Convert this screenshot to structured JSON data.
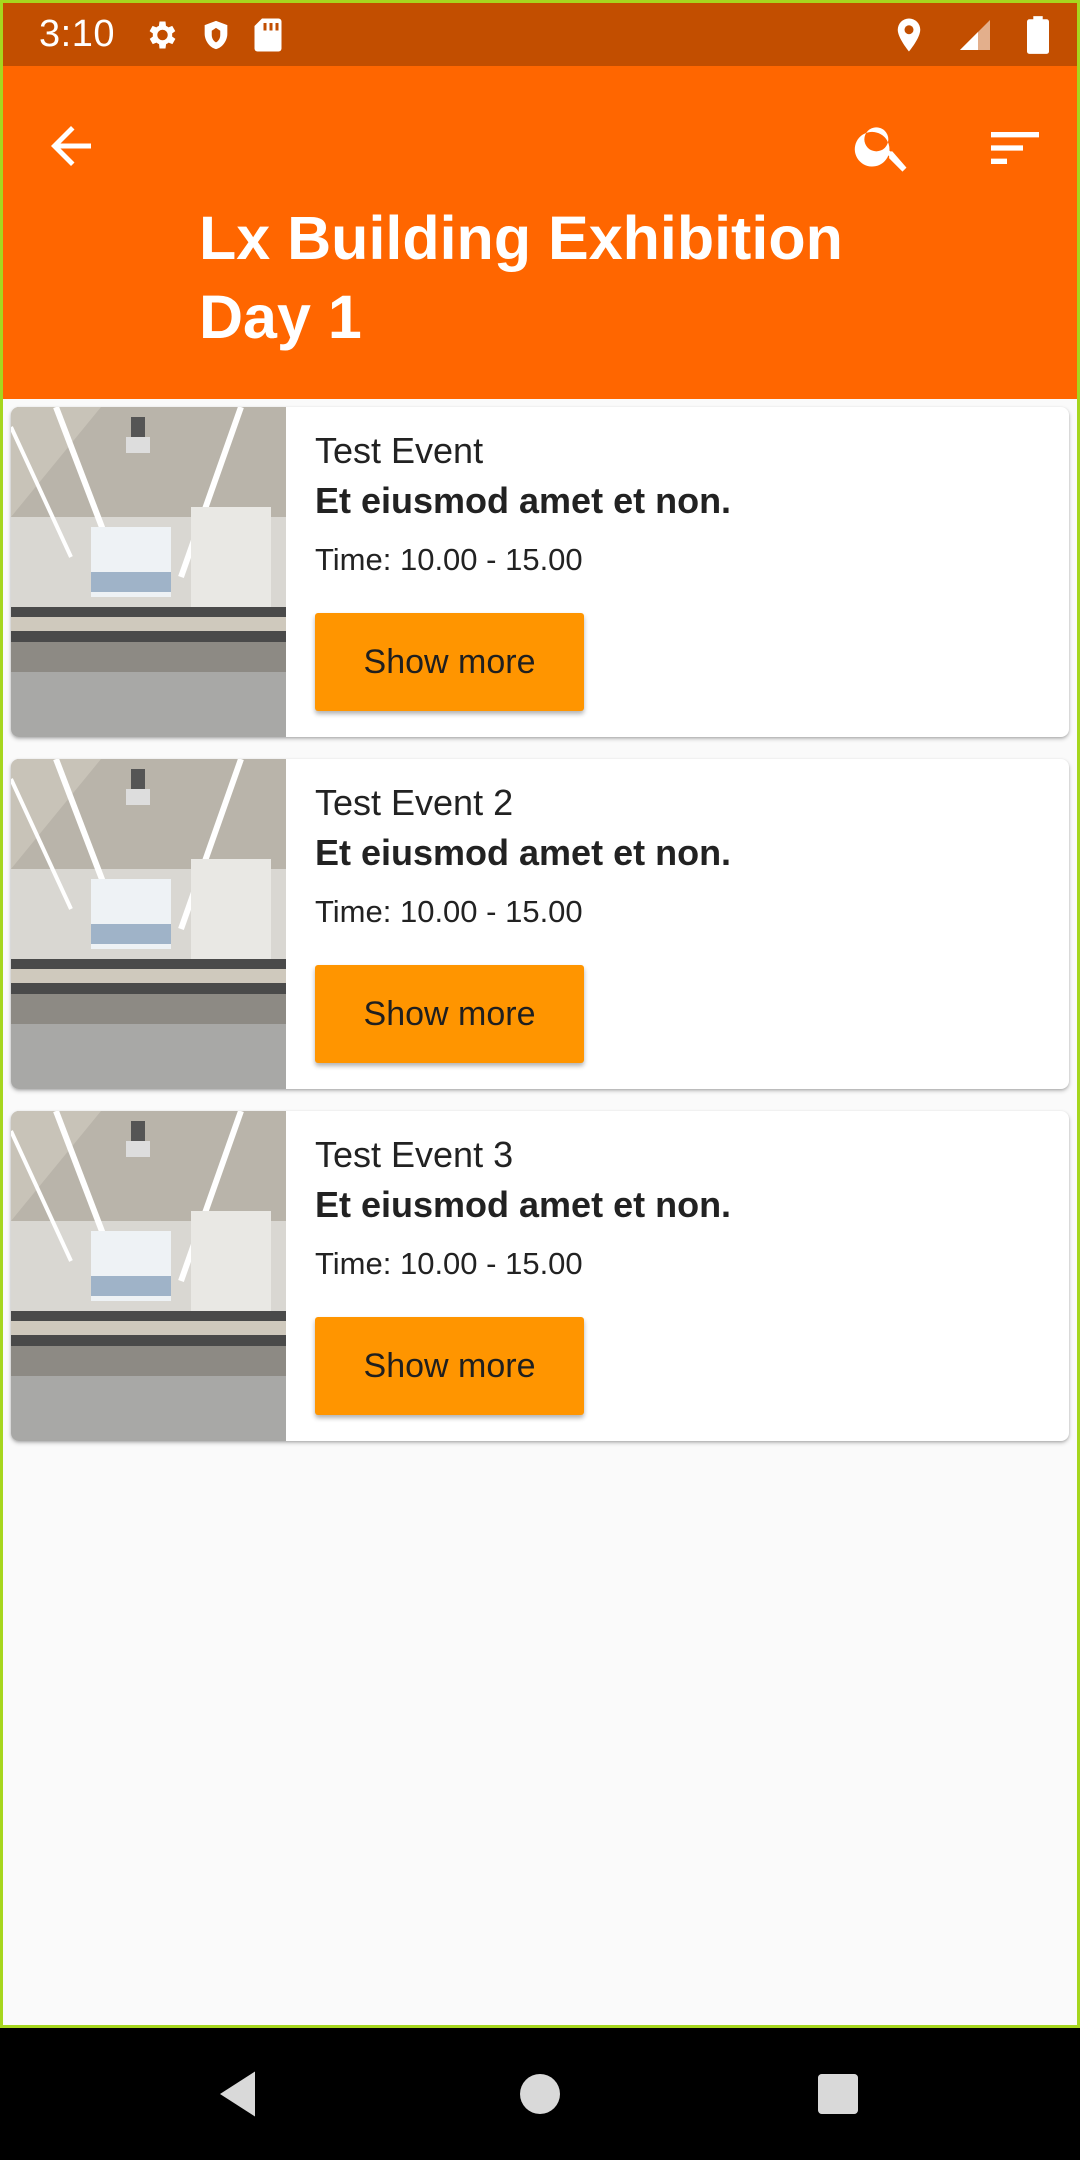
{
  "status_bar": {
    "time": "3:10",
    "left_icons": [
      "settings-icon",
      "shield-icon",
      "sd-card-icon"
    ],
    "right_icons": [
      "location-icon",
      "signal-icon",
      "battery-icon"
    ]
  },
  "app_bar": {
    "title_line1": "Lx Building Exhibition",
    "title_line2": "Day 1",
    "color": "#ff6600",
    "actions": [
      "back-arrow-icon",
      "search-icon",
      "sort-filter-icon"
    ]
  },
  "events": [
    {
      "title": "Test Event",
      "subtitle": "Et eiusmod amet et non.",
      "time": "Time: 10.00 - 15.00",
      "button": "Show more"
    },
    {
      "title": "Test Event 2",
      "subtitle": "Et eiusmod amet et non.",
      "time": "Time: 10.00 - 15.00",
      "button": "Show more"
    },
    {
      "title": "Test Event 3",
      "subtitle": "Et eiusmod amet et non.",
      "time": "Time: 10.00 - 15.00",
      "button": "Show more"
    }
  ],
  "colors": {
    "status_bar": "#c24e00",
    "accent_button": "#ff9500",
    "background": "#fafafa"
  },
  "nav_bar": [
    "nav-back-icon",
    "nav-home-icon",
    "nav-recents-icon"
  ]
}
